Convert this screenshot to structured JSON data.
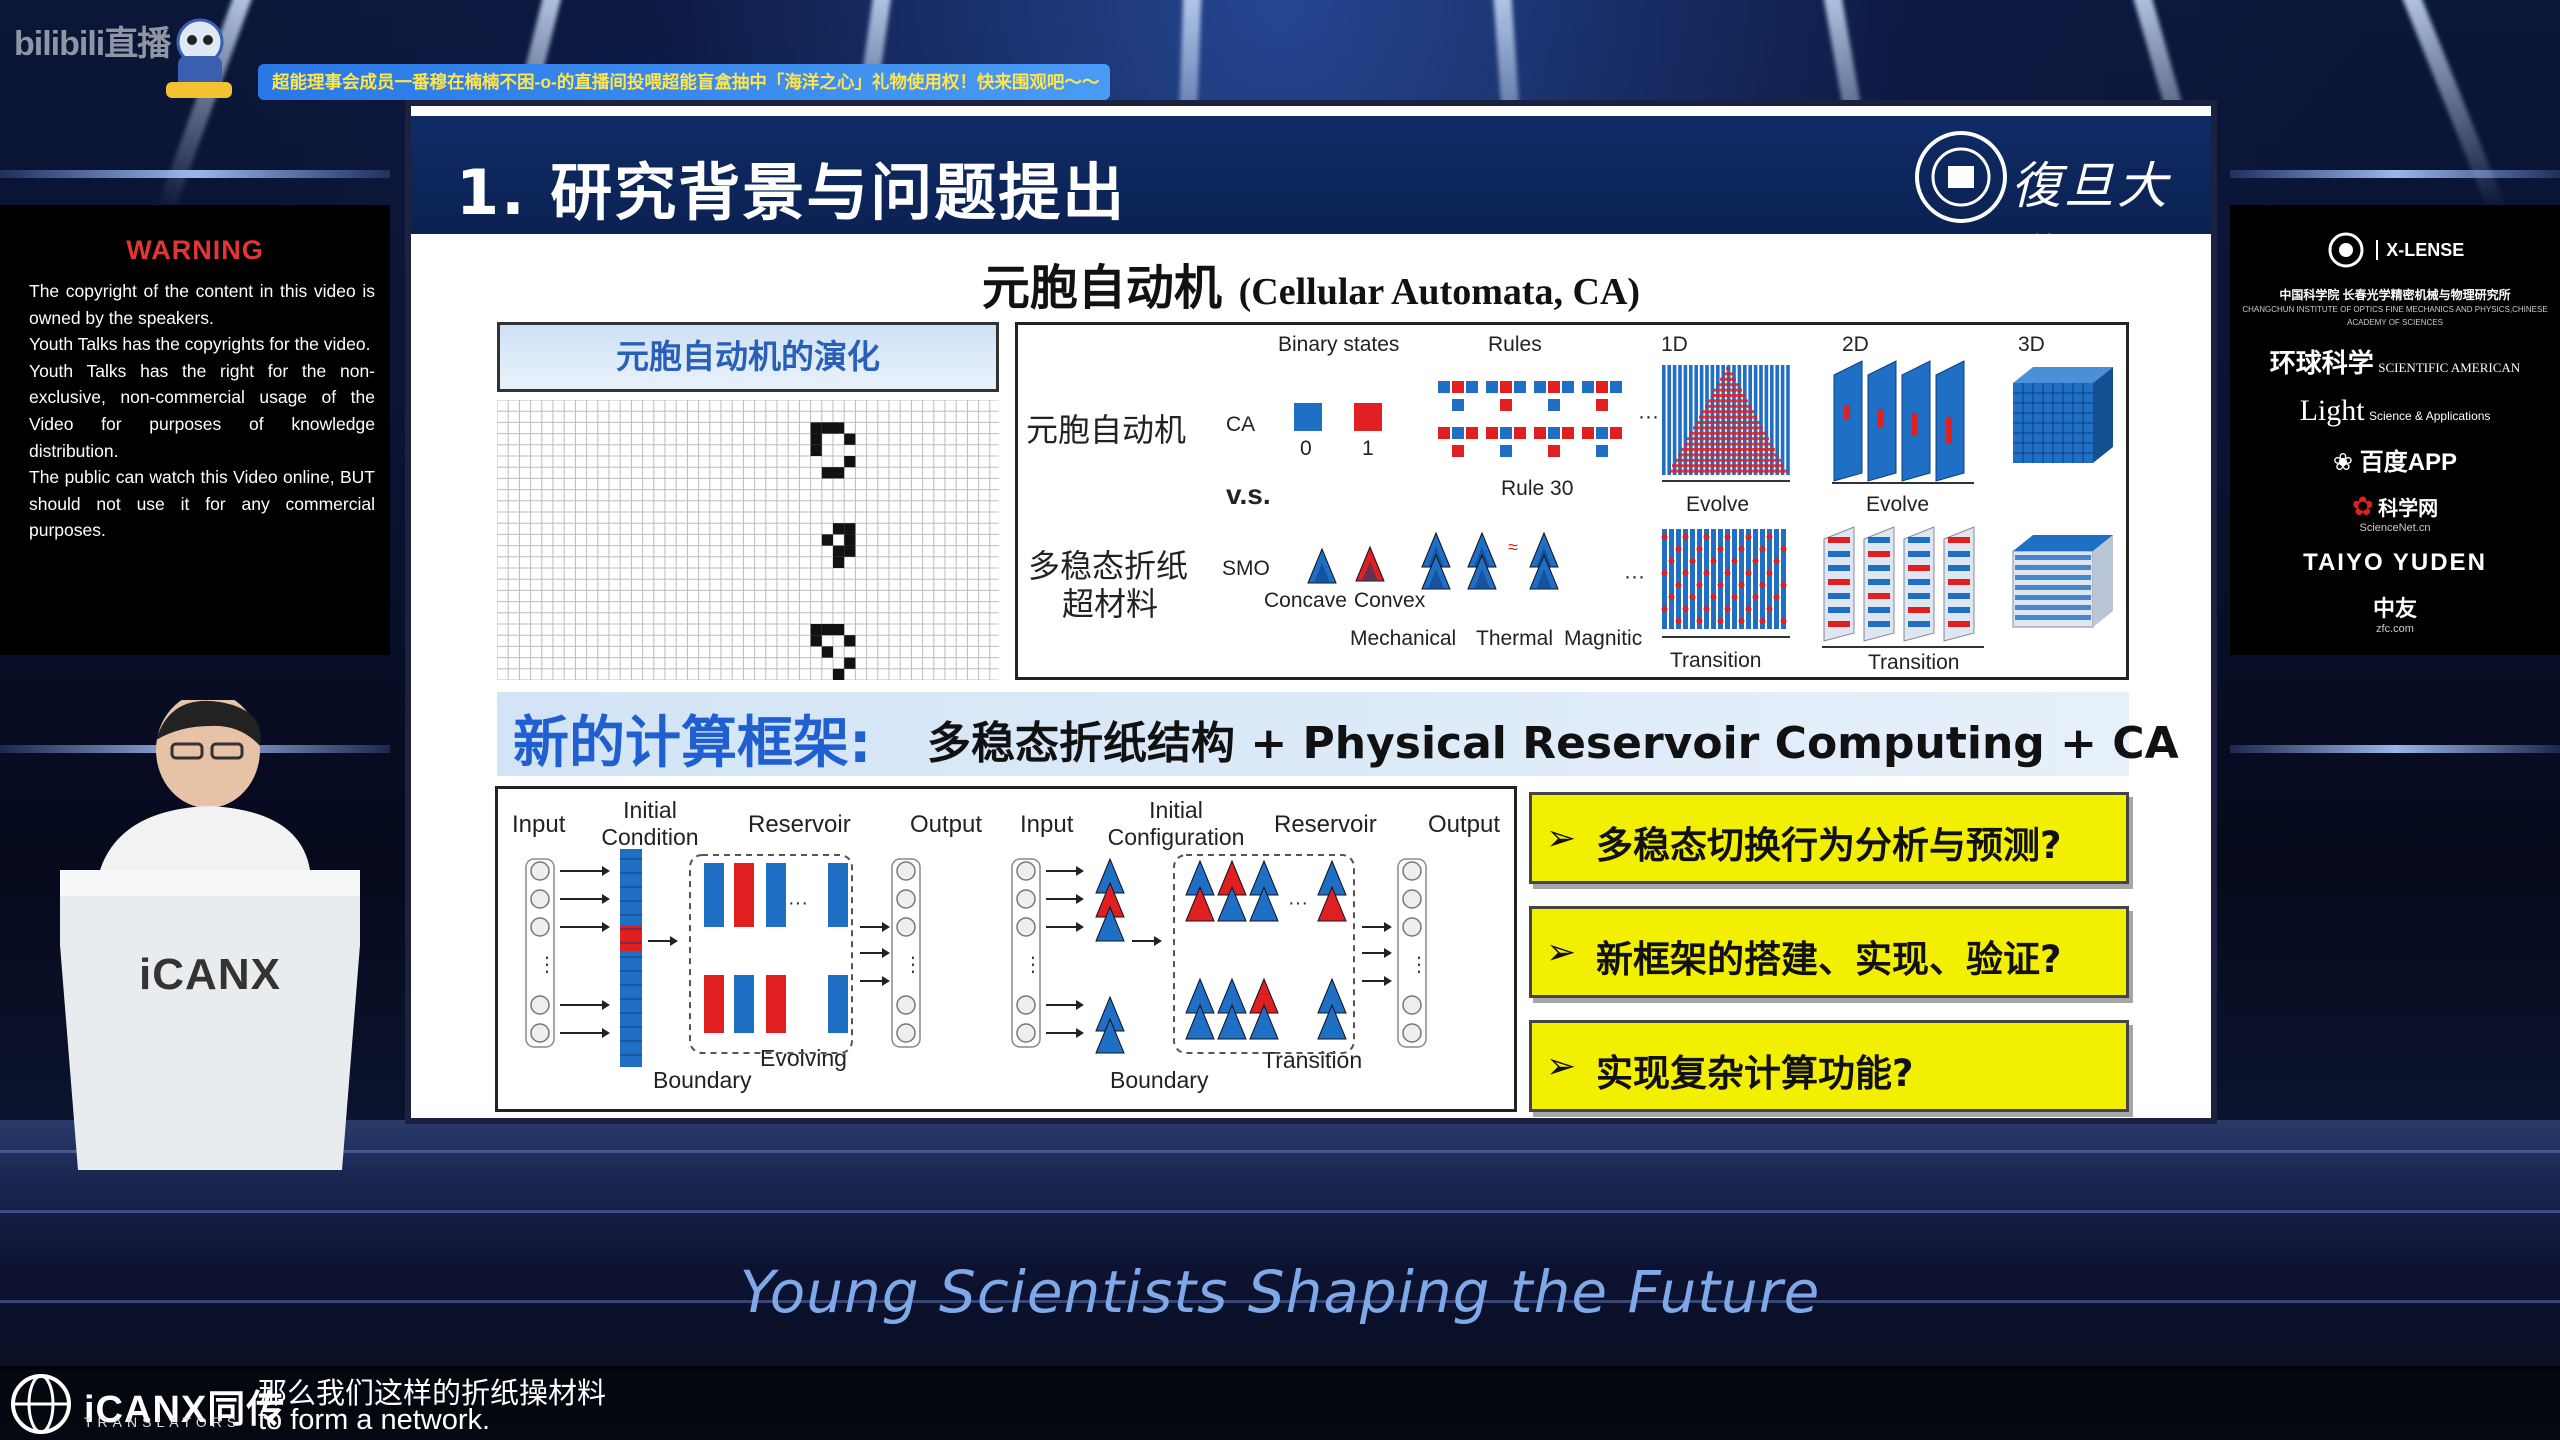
{
  "app": {
    "bili_logo": "bilibili直播",
    "ticker": "超能理事会成员一番穆在楠楠不困-o-的直播间投喂超能盲盒抽中「海洋之心」礼物使用权！快来围观吧～～"
  },
  "warning": {
    "title": "WARNING",
    "lines": [
      "The copyright of the content in this video is owned by the speakers.",
      "Youth Talks has  the copyrights for the video.",
      "Youth Talks has the right for the non-exclusive, non-commercial usage of the Video  for purposes of knowledge distribution.",
      "The public can watch this Video online, BUT should not use it for any commercial purposes."
    ]
  },
  "sponsors": {
    "xlense": "X-LENSE",
    "cas": "中国科学院 长春光学精密机械与物理研究所",
    "cas_en": "CHANGCHUN INSTITUTE OF OPTICS FINE MECHANICS AND PHYSICS,CHINESE ACADEMY OF SCIENCES",
    "sciam": "环球科学",
    "sciam_en": "SCIENTIFIC AMERICAN",
    "light": "Light",
    "light_sub": "Science & Applications",
    "baidu": "百度APP",
    "sciencenet": "科学网",
    "sciencenet_en": "ScienceNet.cn",
    "taiyo": "TAIYO YUDEN",
    "zhongyou": "中友",
    "zhongyou_en": "zfc.com"
  },
  "slide": {
    "title": "1. 研究背景与问题提出",
    "university": "復旦大學",
    "ca_title_cn": "元胞自动机",
    "ca_title_en": "(Cellular Automata, CA)",
    "evolution_label": "元胞自动机的演化",
    "right_panel": {
      "binary_states": "Binary states",
      "rules": "Rules",
      "d1": "1D",
      "d2": "2D",
      "d3": "3D",
      "ca_cn": "元胞自动机",
      "ca_abbr": "CA",
      "zero": "0",
      "one": "1",
      "rule30": "Rule 30",
      "evolve1": "Evolve",
      "evolve2": "Evolve",
      "vs": "v.s.",
      "smo_cn1": "多稳态折纸",
      "smo_cn2": "超材料",
      "smo_abbr": "SMO",
      "concave": "Concave",
      "convex": "Convex",
      "mechanical": "Mechanical",
      "thermal": "Thermal",
      "magnetic": "Magnitic",
      "transition1": "Transition",
      "transition2": "Transition",
      "ellipsis": "···"
    },
    "banner": {
      "lead": "新的计算框架:",
      "rest": "多稳态折纸结构 + Physical Reservoir Computing + CA"
    },
    "diagram": {
      "input1": "Input",
      "initial_condition": "Initial Condition",
      "reservoir1": "Reservoir",
      "output1": "Output",
      "boundary1": "Boundary",
      "evolving": "Evolving",
      "input2": "Input",
      "initial_configuration": "Initial Configuration",
      "reservoir2": "Reservoir",
      "output2": "Output",
      "boundary2": "Boundary",
      "transition": "Transition"
    },
    "questions": [
      "多稳态切换行为分析与预测?",
      "新框架的搭建、实现、验证?",
      "实现复杂计算功能?"
    ]
  },
  "stage": {
    "podium_brand": "iCANX",
    "tagline": "Young Scientists Shaping the Future"
  },
  "subtitles": {
    "cn": "那么我们这样的折纸操材料",
    "en": "to form a network."
  },
  "translators": {
    "brand": "iCANX同传",
    "sub": "TRANSLATORS"
  },
  "colors": {
    "blue_cell": "#1f6fc4",
    "red_cell": "#e02020",
    "question_yellow": "#f3ef00",
    "header_navy": "#0f2c66"
  }
}
